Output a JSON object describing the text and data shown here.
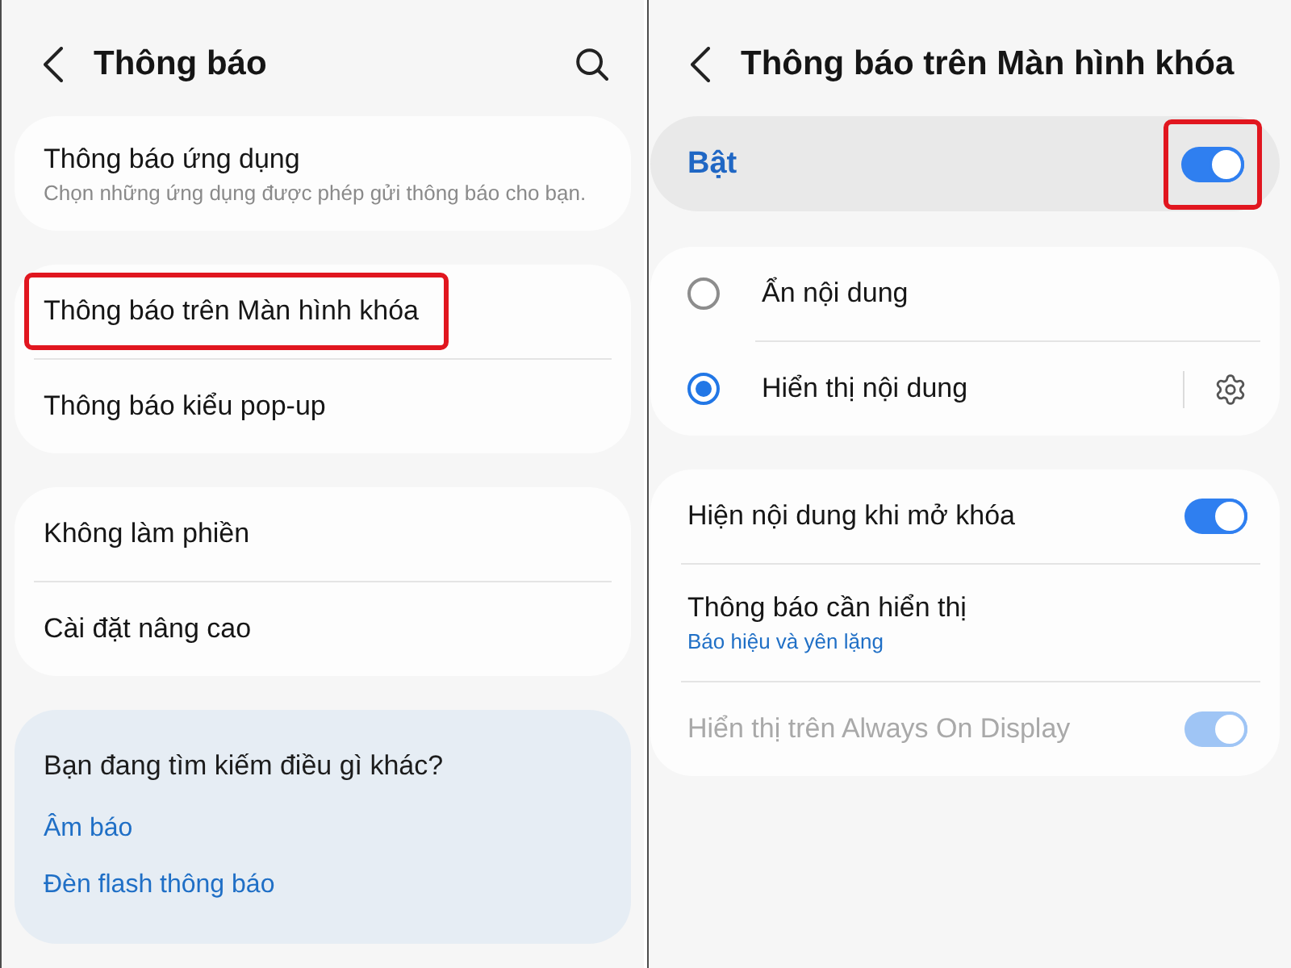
{
  "left_screen": {
    "header": {
      "title": "Thông báo"
    },
    "groups": [
      {
        "items": [
          {
            "title": "Thông báo ứng dụng",
            "subtitle": "Chọn những ứng dụng được phép gửi thông báo cho bạn.",
            "highlighted": false
          }
        ]
      },
      {
        "items": [
          {
            "title": "Thông báo trên Màn hình khóa",
            "highlighted": true
          },
          {
            "title": "Thông báo kiểu pop-up",
            "highlighted": false
          }
        ]
      },
      {
        "items": [
          {
            "title": "Không làm phiền",
            "highlighted": false
          },
          {
            "title": "Cài đặt nâng cao",
            "highlighted": false
          }
        ]
      }
    ],
    "suggestions": {
      "heading": "Bạn đang tìm kiếm điều gì khác?",
      "links": [
        "Âm báo",
        "Đèn flash thông báo"
      ]
    }
  },
  "right_screen": {
    "header": {
      "title": "Thông báo trên Màn hình khóa"
    },
    "master_switch": {
      "label": "Bật",
      "on": true,
      "highlighted": true
    },
    "content_options": [
      {
        "label": "Ẩn nội dung",
        "selected": false,
        "settings_button": false
      },
      {
        "label": "Hiển thị nội dung",
        "selected": true,
        "settings_button": true
      }
    ],
    "settings": [
      {
        "kind": "switch",
        "title": "Hiện nội dung khi mở khóa",
        "on": true,
        "disabled": false
      },
      {
        "kind": "link",
        "title": "Thông báo cần hiển thị",
        "subtitle": "Báo hiệu và yên lặng",
        "disabled": false
      },
      {
        "kind": "switch",
        "title": "Hiển thị trên Always On Display",
        "on": true,
        "disabled": true
      }
    ]
  }
}
